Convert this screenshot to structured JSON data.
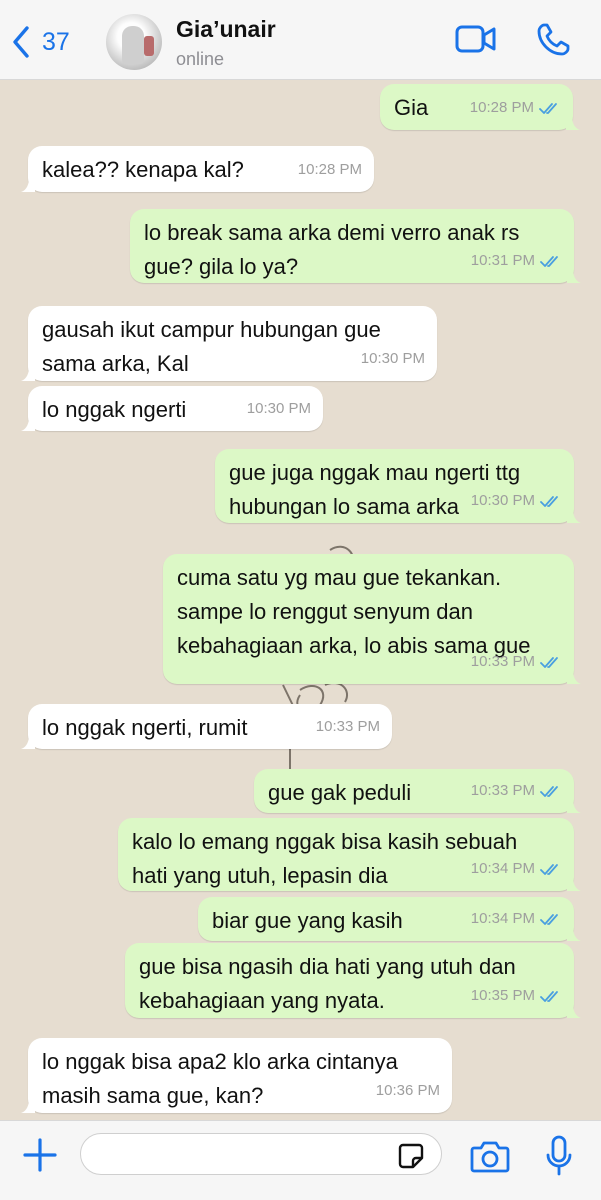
{
  "header": {
    "back_count": "37",
    "contact_name": "Gia’unair",
    "contact_status": "online"
  },
  "colors": {
    "accent": "#1a73e8",
    "outgoing_bubble": "#dcf8c6",
    "incoming_bubble": "#ffffff",
    "chat_background": "#e6ddd0",
    "read_ticks": "#4a9fe0"
  },
  "messages": [
    {
      "dir": "out",
      "text": "Gia",
      "time": "10:28 PM",
      "read": true
    },
    {
      "dir": "in",
      "text": "kalea?? kenapa kal?",
      "time": "10:28 PM"
    },
    {
      "dir": "out",
      "text": "lo break sama arka demi verro anak rs\ngue? gila lo ya?",
      "time": "10:31 PM",
      "read": true
    },
    {
      "dir": "in",
      "text": "gausah ikut campur hubungan gue\nsama arka, Kal",
      "time": "10:30 PM"
    },
    {
      "dir": "in",
      "text": "lo nggak ngerti",
      "time": "10:30 PM"
    },
    {
      "dir": "out",
      "text": "gue juga nggak mau ngerti ttg\nhubungan lo sama arka",
      "time": "10:30 PM",
      "read": true
    },
    {
      "dir": "out",
      "text": "cuma satu yg mau gue tekankan.\nsampe lo renggut senyum dan\nkebahagiaan arka, lo abis sama gue",
      "time": "10:33 PM",
      "read": true
    },
    {
      "dir": "in",
      "text": "lo nggak ngerti, rumit",
      "time": "10:33 PM"
    },
    {
      "dir": "out",
      "text": "gue gak peduli",
      "time": "10:33 PM",
      "read": true
    },
    {
      "dir": "out",
      "text": "kalo lo emang nggak bisa kasih sebuah\nhati yang utuh, lepasin dia",
      "time": "10:34 PM",
      "read": true
    },
    {
      "dir": "out",
      "text": "biar gue yang kasih",
      "time": "10:34 PM",
      "read": true
    },
    {
      "dir": "out",
      "text": "gue bisa ngasih dia hati yang utuh dan\nkebahagiaan yang nyata.",
      "time": "10:35 PM",
      "read": true
    },
    {
      "dir": "in",
      "text": "lo nggak bisa apa2 klo arka cintanya\nmasih sama gue, kan?",
      "time": "10:36 PM"
    }
  ],
  "composer": {
    "value": ""
  },
  "icons": {
    "back": "chevron-left-icon",
    "video": "video-camera-icon",
    "phone": "phone-icon",
    "plus": "plus-icon",
    "sticker": "sticker-icon",
    "camera": "camera-icon",
    "mic": "microphone-icon"
  }
}
